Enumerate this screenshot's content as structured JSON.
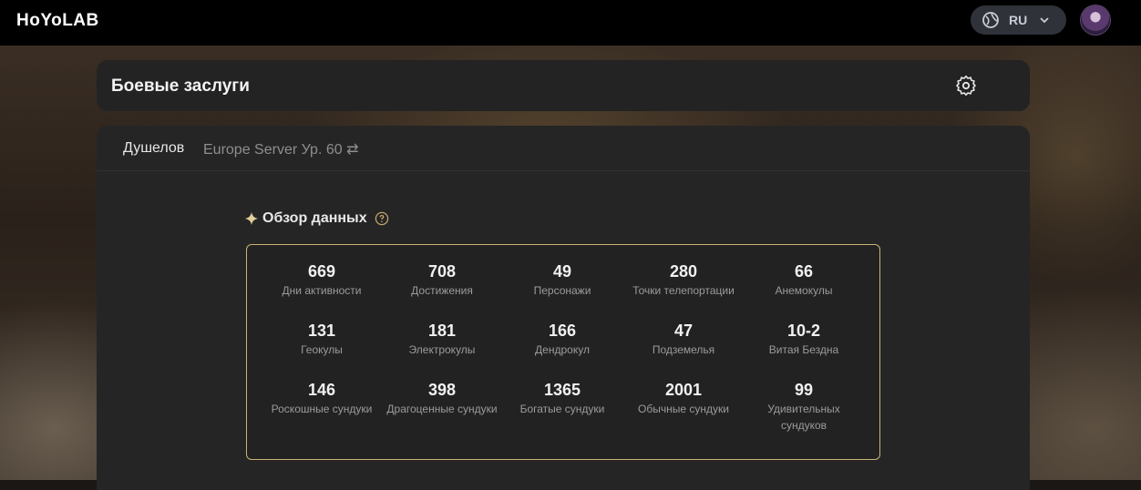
{
  "header": {
    "logo": "HoYoLAB",
    "language": "RU",
    "icons": [
      "globe-icon",
      "chevron-down-icon"
    ]
  },
  "page": {
    "title": "Боевые заслуги"
  },
  "profile": {
    "nickname": "Душелов",
    "server": "Europe Server Ур. 60 ⇄"
  },
  "overview": {
    "title": "Обзор данных",
    "stats": [
      {
        "value": "669",
        "label": "Дни активности"
      },
      {
        "value": "708",
        "label": "Достижения"
      },
      {
        "value": "49",
        "label": "Персонажи"
      },
      {
        "value": "280",
        "label": "Точки телепортации"
      },
      {
        "value": "66",
        "label": "Анемокулы"
      },
      {
        "value": "131",
        "label": "Геокулы"
      },
      {
        "value": "181",
        "label": "Электрокулы"
      },
      {
        "value": "166",
        "label": "Дендрокул"
      },
      {
        "value": "47",
        "label": "Подземелья"
      },
      {
        "value": "10-2",
        "label": "Витая Бездна"
      },
      {
        "value": "146",
        "label": "Роскошные сундуки"
      },
      {
        "value": "398",
        "label": "Драгоценные сундуки"
      },
      {
        "value": "1365",
        "label": "Богатые сундуки"
      },
      {
        "value": "2001",
        "label": "Обычные сундуки"
      },
      {
        "value": "99",
        "label": "Удивительных сундуков"
      }
    ]
  },
  "colors": {
    "accent_border": "#c8b47a",
    "card_bg": "#252525",
    "topbar_bg": "#000000"
  }
}
